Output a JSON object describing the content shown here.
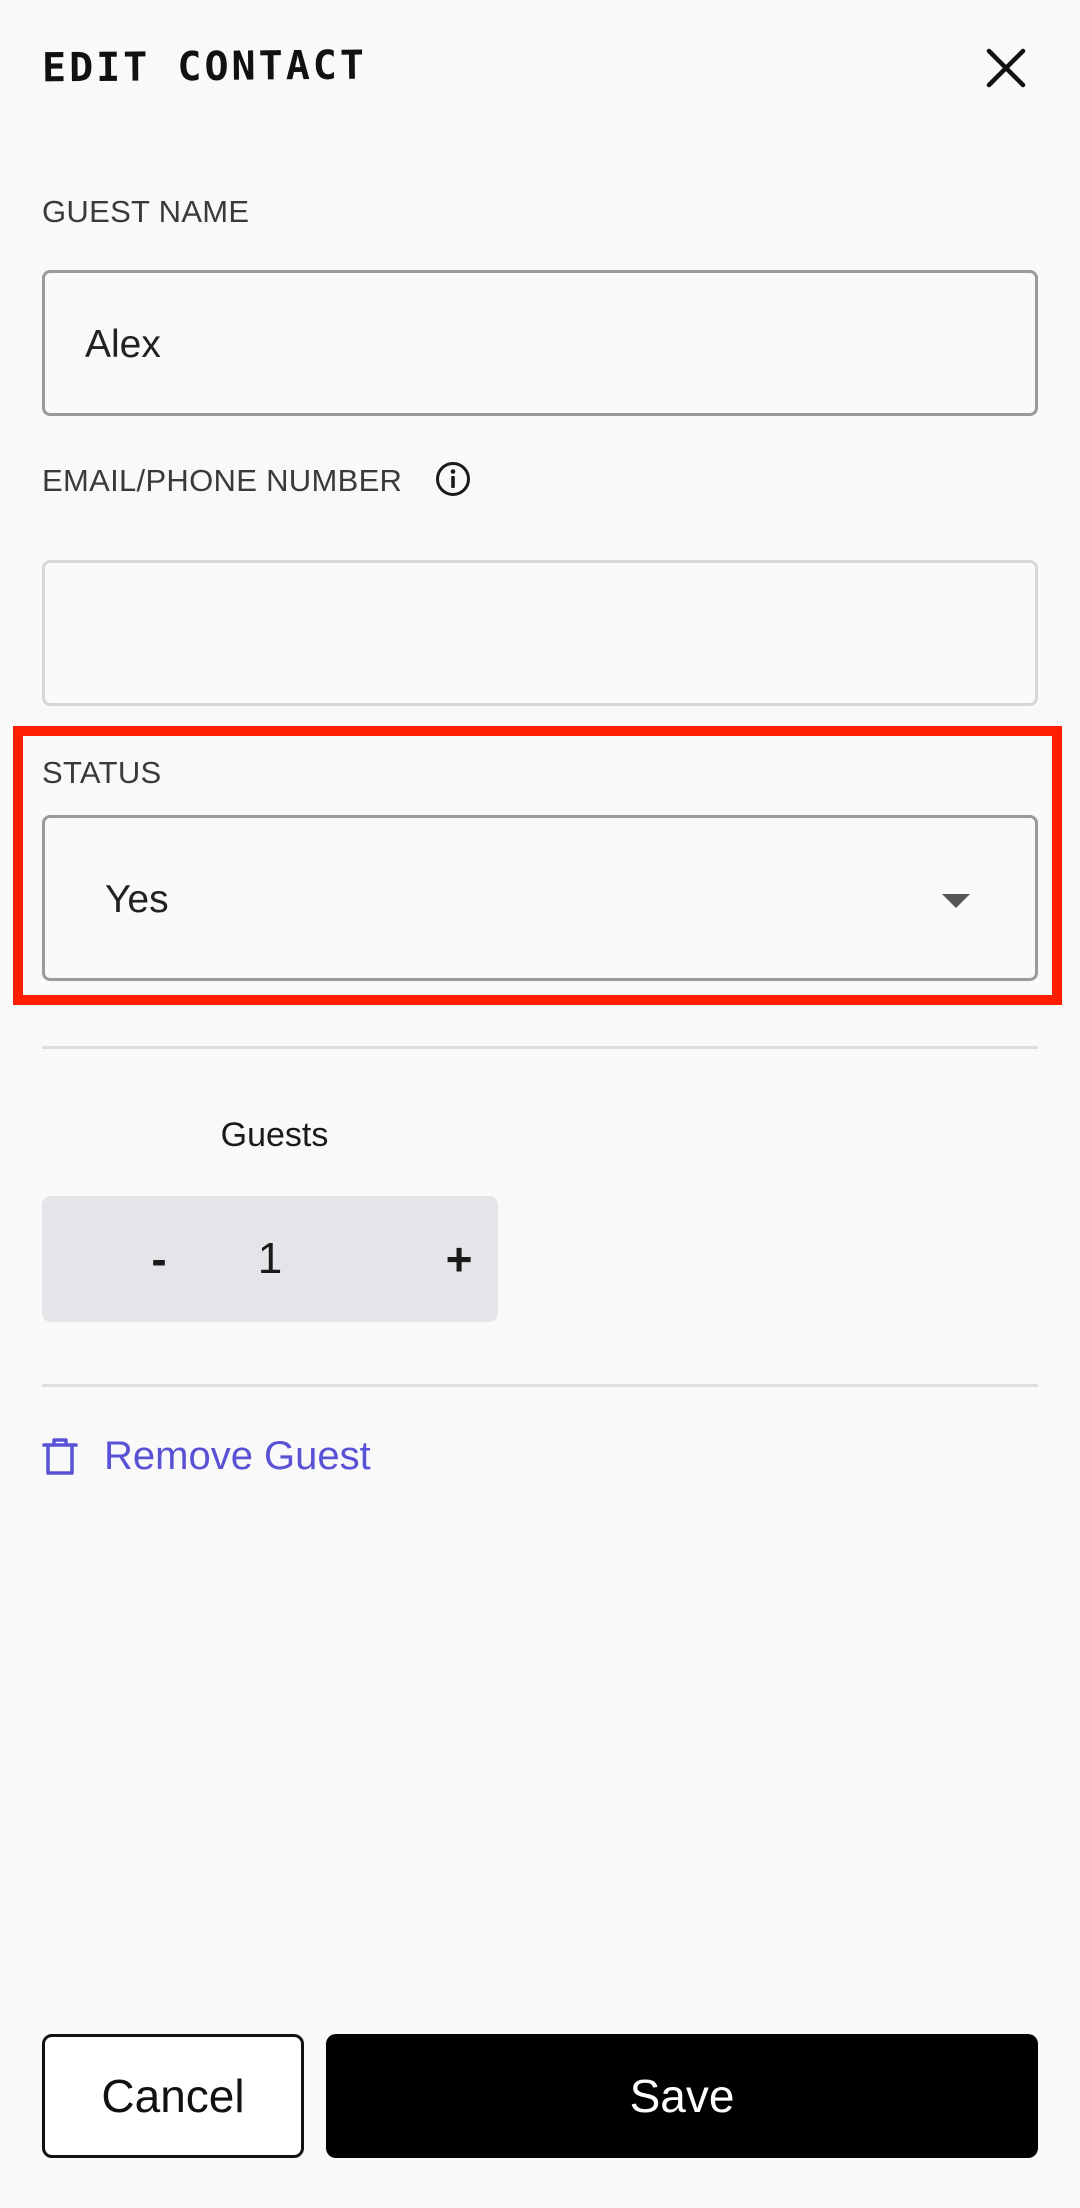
{
  "header": {
    "title": "EDIT CONTACT",
    "close_icon": "close-icon"
  },
  "form": {
    "guest_name_label": "GUEST NAME",
    "guest_name_value": "Alex",
    "contact_label": "EMAIL/PHONE NUMBER",
    "contact_info_icon": "info-icon",
    "contact_value": "",
    "status_label": "STATUS",
    "status_value": "Yes",
    "guests_label": "Guests",
    "guests_decrement": "-",
    "guests_count": "1",
    "guests_increment": "+",
    "remove_label": "Remove Guest",
    "remove_icon": "trash-icon"
  },
  "actions": {
    "cancel_label": "Cancel",
    "save_label": "Save"
  },
  "colors": {
    "accent": "#5a52d5",
    "highlight": "#ff1e00",
    "save_bg": "#000000"
  }
}
